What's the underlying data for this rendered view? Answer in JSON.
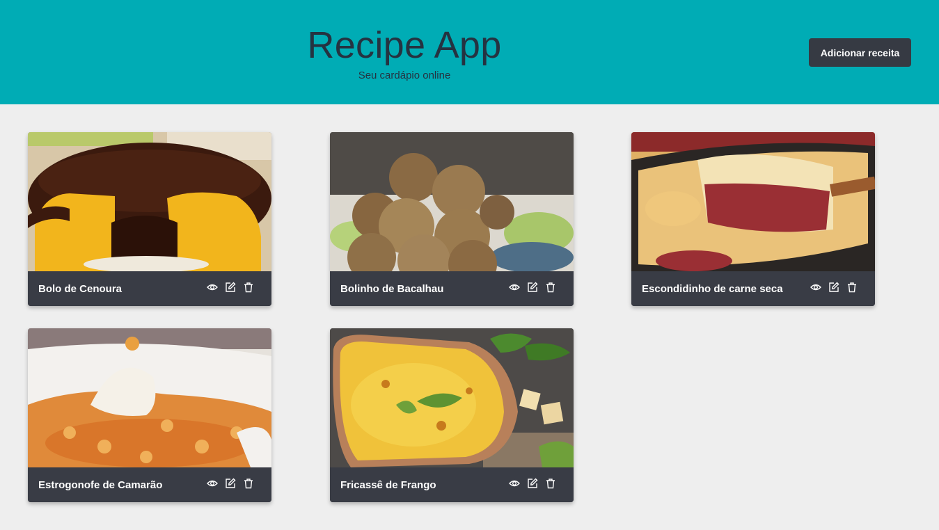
{
  "header": {
    "title": "Recipe App",
    "subtitle": "Seu cardápio online",
    "add_button": "Adicionar receita"
  },
  "colors": {
    "header_bg": "#00acb5",
    "page_bg": "#eeeeee",
    "card_bar": "#393c45",
    "button_bg": "#363a43"
  },
  "icons": {
    "view": "eye-icon",
    "edit": "edit-icon",
    "delete": "trash-icon"
  },
  "recipes": [
    {
      "name": "Bolo de Cenoura"
    },
    {
      "name": "Bolinho de Bacalhau"
    },
    {
      "name": "Escondidinho de carne seca"
    },
    {
      "name": "Estrogonofe de Camarão"
    },
    {
      "name": "Fricassê de Frango"
    }
  ]
}
